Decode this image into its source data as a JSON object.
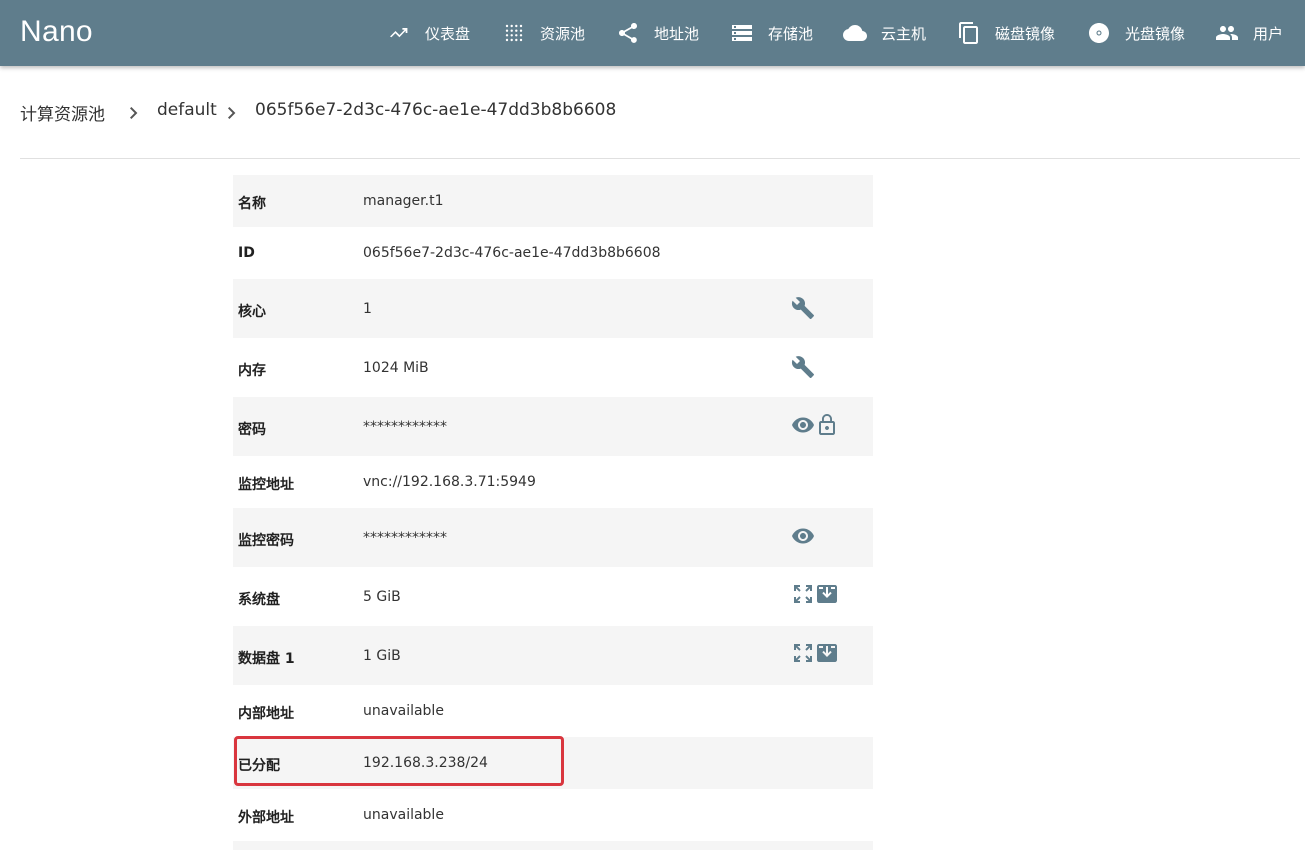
{
  "app": {
    "title": "Nano"
  },
  "nav": [
    {
      "label": "仪表盘",
      "icon": "trending-icon"
    },
    {
      "label": "资源池",
      "icon": "grid-dots-icon"
    },
    {
      "label": "地址池",
      "icon": "share-icon"
    },
    {
      "label": "存储池",
      "icon": "storage-icon"
    },
    {
      "label": "云主机",
      "icon": "cloud-icon"
    },
    {
      "label": "磁盘镜像",
      "icon": "copy-icon"
    },
    {
      "label": "光盘镜像",
      "icon": "disc-icon"
    },
    {
      "label": "用户",
      "icon": "people-icon"
    }
  ],
  "breadcrumb": [
    "计算资源池",
    "default",
    "065f56e7-2d3c-476c-ae1e-47dd3b8b6608"
  ],
  "details": [
    {
      "key": "名称",
      "value": "manager.t1"
    },
    {
      "key": "ID",
      "value": "065f56e7-2d3c-476c-ae1e-47dd3b8b6608"
    },
    {
      "key": "核心",
      "value": "1",
      "actions": [
        "wrench-icon"
      ]
    },
    {
      "key": "内存",
      "value": "1024 MiB",
      "actions": [
        "wrench-icon"
      ]
    },
    {
      "key": "密码",
      "value": "************",
      "actions": [
        "eye-icon",
        "lock-icon"
      ]
    },
    {
      "key": "监控地址",
      "value": "vnc://192.168.3.71:5949"
    },
    {
      "key": "监控密码",
      "value": "************",
      "actions": [
        "eye-icon"
      ]
    },
    {
      "key": "系统盘",
      "value": "5 GiB",
      "actions": [
        "resize-icon",
        "download-icon"
      ]
    },
    {
      "key": "数据盘 1",
      "value": "1 GiB",
      "actions": [
        "resize-icon",
        "download-icon"
      ]
    },
    {
      "key": "内部地址",
      "value": "unavailable"
    },
    {
      "key": "已分配",
      "value": "192.168.3.238/24"
    },
    {
      "key": "外部地址",
      "value": "unavailable"
    }
  ],
  "colors": {
    "appbar": "#5f7d8c",
    "highlight": "#d9363e",
    "row_shade": "#f5f5f5"
  }
}
